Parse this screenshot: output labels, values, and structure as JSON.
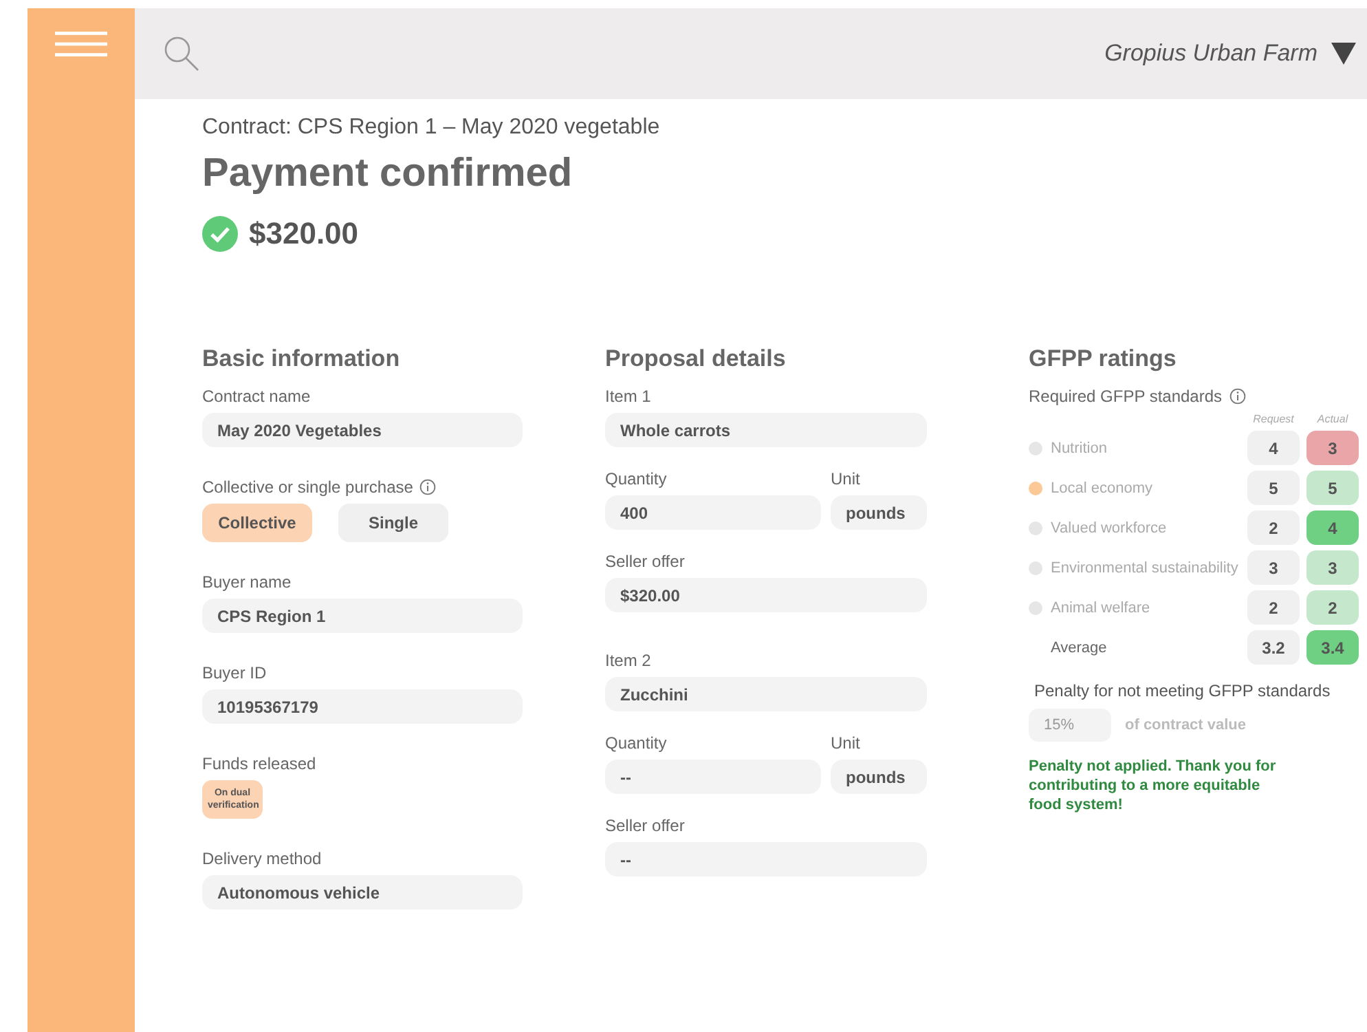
{
  "topbar": {
    "account": "Gropius Urban Farm"
  },
  "contract": "Contract:  CPS Region 1 – May 2020 vegetable",
  "title": "Payment confirmed",
  "amount": {
    "value": "$320.00",
    "confirmed": true
  },
  "basic": {
    "heading": "Basic information",
    "items": [
      {
        "kind": "field",
        "label": "Contract name",
        "value": "May 2020 Vegetables"
      },
      {
        "kind": "toggle",
        "label": "Collective or single purchase",
        "info": true,
        "options": [
          {
            "label": "Collective",
            "selected": true
          },
          {
            "label": "Single",
            "selected": false
          }
        ]
      },
      {
        "kind": "field",
        "label": "Buyer name",
        "value": "CPS Region 1"
      },
      {
        "kind": "field",
        "label": "Buyer ID",
        "value": "10195367179"
      },
      {
        "kind": "badge",
        "label": "Funds released",
        "value": "On dual verification"
      },
      {
        "kind": "field",
        "label": "Delivery method",
        "value": "Autonomous vehicle"
      }
    ]
  },
  "proposal": {
    "heading": "Proposal details",
    "items": [
      {
        "label": "Item 1",
        "name": "Whole carrots",
        "quantity_label": "Quantity",
        "quantity": "400",
        "unit_label": "Unit",
        "unit": "pounds",
        "offer_label": "Seller offer",
        "offer": "$320.00"
      },
      {
        "label": "Item 2",
        "name": "Zucchini",
        "quantity_label": "Quantity",
        "quantity": "--",
        "unit_label": "Unit",
        "unit": "pounds",
        "offer_label": "Seller offer",
        "offer": "--"
      }
    ]
  },
  "ratings": {
    "heading": "GFPP ratings",
    "subheading": "Required GFPP standards",
    "col_request": "Request",
    "col_actual": "Actual",
    "rows": [
      {
        "name": "Nutrition",
        "color": "#e6e6e6",
        "request": "4",
        "actual": "3",
        "kind": "below"
      },
      {
        "name": "Local economy",
        "color": "#fbc896",
        "request": "5",
        "actual": "5",
        "kind": "met"
      },
      {
        "name": "Valued workforce",
        "color": "#e6e6e6",
        "request": "2",
        "actual": "4",
        "kind": "exceeded"
      },
      {
        "name": "Environmental sustainability",
        "color": "#e6e6e6",
        "request": "3",
        "actual": "3",
        "kind": "met"
      },
      {
        "name": "Animal welfare",
        "color": "#e6e6e6",
        "request": "2",
        "actual": "2",
        "kind": "met"
      }
    ],
    "average": {
      "name": "Average",
      "request": "3.2",
      "actual": "3.4",
      "kind": "exceeded"
    },
    "penalty_label": "Penalty for not meeting GFPP standards",
    "penalty": {
      "placeholder": "15%"
    },
    "penalty_suffix": "of contract value",
    "message": "Penalty not applied. Thank you for contributing to a more equitable food system!"
  }
}
